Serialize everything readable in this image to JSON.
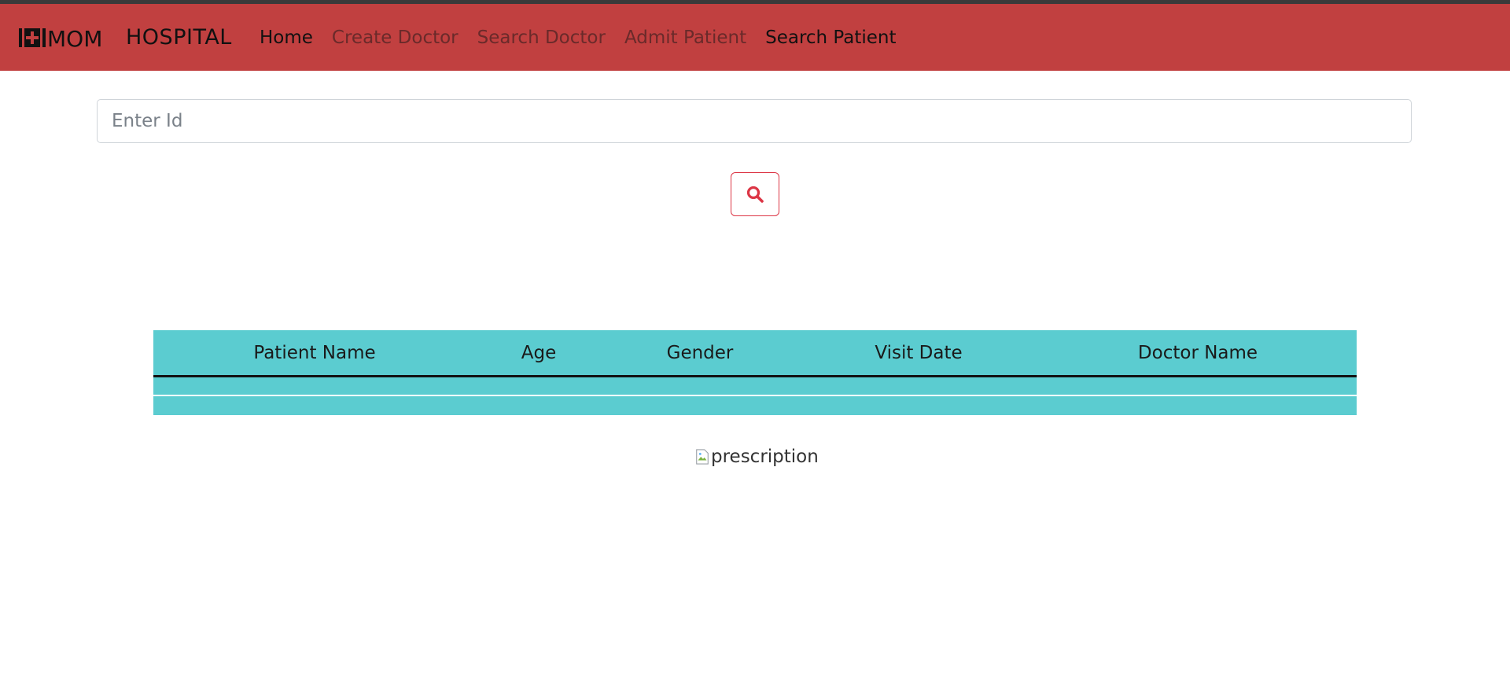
{
  "brand": {
    "logo_text": "MOM",
    "name": "HOSPITAL"
  },
  "nav": {
    "items": [
      {
        "label": "Home"
      },
      {
        "label": "Create Doctor"
      },
      {
        "label": "Search Doctor"
      },
      {
        "label": "Admit Patient"
      },
      {
        "label": "Search Patient"
      }
    ]
  },
  "search": {
    "placeholder": "Enter Id",
    "value": "",
    "button_icon": "search-icon"
  },
  "table": {
    "columns": [
      "Patient Name",
      "Age",
      "Gender",
      "Visit Date",
      "Doctor Name"
    ],
    "rows": [
      [
        "",
        "",
        "",
        "",
        ""
      ],
      [
        "",
        "",
        "",
        "",
        ""
      ]
    ]
  },
  "prescription_image": {
    "alt": "prescription"
  },
  "colors": {
    "navbar": "#c14040",
    "table_bg": "#5bccd0",
    "search_button_border": "#dc3545"
  }
}
